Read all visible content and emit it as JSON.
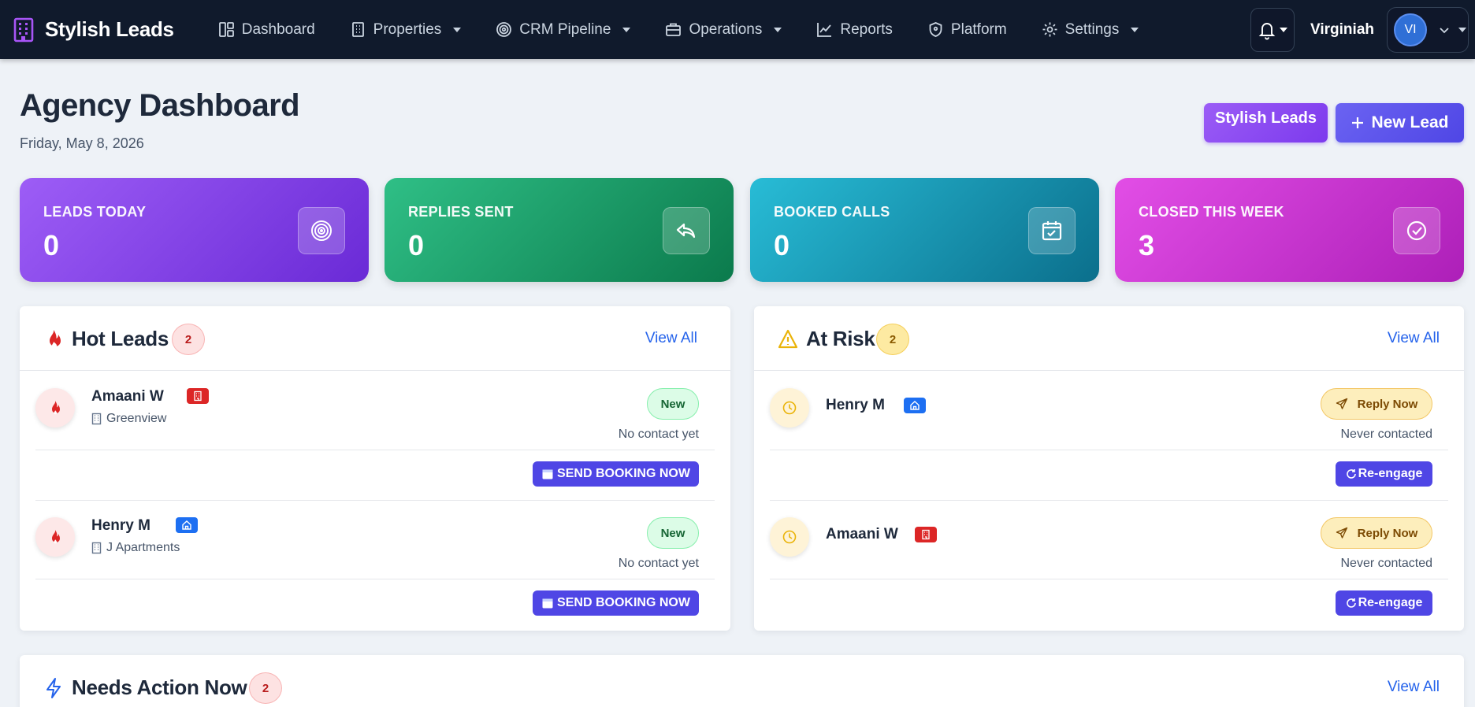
{
  "nav": {
    "brand": "Stylish Leads",
    "items": [
      {
        "label": "Dashboard",
        "icon": "dashboard-icon",
        "dropdown": false
      },
      {
        "label": "Properties",
        "icon": "building-icon",
        "dropdown": true
      },
      {
        "label": "CRM Pipeline",
        "icon": "target-icon",
        "dropdown": true
      },
      {
        "label": "Operations",
        "icon": "briefcase-icon",
        "dropdown": true
      },
      {
        "label": "Reports",
        "icon": "chart-line-icon",
        "dropdown": false
      },
      {
        "label": "Platform",
        "icon": "shield-icon",
        "dropdown": false
      },
      {
        "label": "Settings",
        "icon": "gear-icon",
        "dropdown": true
      }
    ],
    "user_name": "Virginiah",
    "avatar_initials": "VI"
  },
  "header": {
    "title": "Agency Dashboard",
    "date": "Friday, May 8, 2026",
    "brand_button": "Stylish Leads",
    "new_lead_button": "New Lead"
  },
  "stats": [
    {
      "label": "LEADS TODAY",
      "value": "0",
      "icon": "target-icon"
    },
    {
      "label": "REPLIES SENT",
      "value": "0",
      "icon": "reply-icon"
    },
    {
      "label": "BOOKED CALLS",
      "value": "0",
      "icon": "calendar-check-icon"
    },
    {
      "label": "CLOSED THIS WEEK",
      "value": "3",
      "icon": "check-circle-icon"
    }
  ],
  "hot_leads": {
    "title": "Hot Leads",
    "count": "2",
    "view_all": "View All",
    "items": [
      {
        "name": "Amaani W",
        "tag": "building",
        "property": "Greenview",
        "status": "New",
        "contact": "No contact yet",
        "action": "SEND BOOKING NOW"
      },
      {
        "name": "Henry M",
        "tag": "home",
        "property": "J Apartments",
        "status": "New",
        "contact": "No contact yet",
        "action": "SEND BOOKING NOW"
      }
    ]
  },
  "at_risk": {
    "title": "At Risk",
    "count": "2",
    "view_all": "View All",
    "items": [
      {
        "name": "Henry M",
        "tag": "home",
        "status": "Reply Now",
        "contact": "Never contacted",
        "action": "Re-engage"
      },
      {
        "name": "Amaani W",
        "tag": "building",
        "status": "Reply Now",
        "contact": "Never contacted",
        "action": "Re-engage"
      }
    ]
  },
  "needs_action": {
    "title": "Needs Action Now",
    "count": "2",
    "view_all": "View All"
  },
  "colors": {
    "navbar": "#101a2c",
    "accent": "#4f46e5",
    "brand_purple": "#7c3aed",
    "link": "#2563eb"
  }
}
